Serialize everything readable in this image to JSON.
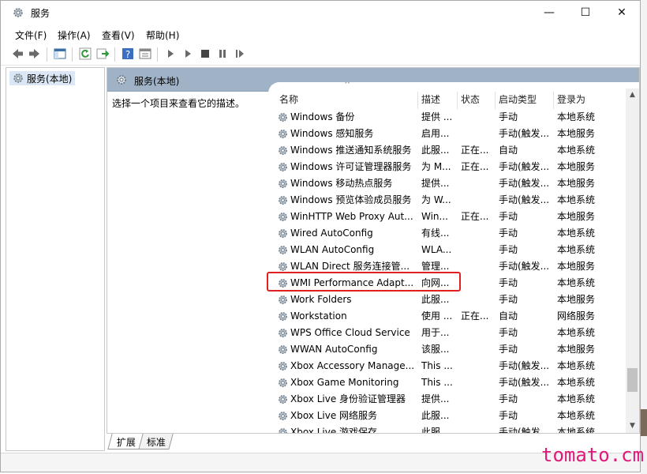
{
  "window": {
    "title": "服务"
  },
  "window_controls": {
    "minimize": "—",
    "maximize": "☐",
    "close": "✕"
  },
  "menu": [
    {
      "label": "文件(F)"
    },
    {
      "label": "操作(A)"
    },
    {
      "label": "查看(V)"
    },
    {
      "label": "帮助(H)"
    }
  ],
  "toolbar": {
    "icons": [
      "back-icon",
      "forward-icon",
      "show-hide-tree-icon",
      "refresh-icon",
      "export-icon",
      "help-icon",
      "properties-icon",
      "start-icon",
      "start-alt-icon",
      "stop-icon",
      "pause-icon",
      "restart-icon"
    ]
  },
  "tree": {
    "selected_label": "服务(本地)"
  },
  "main": {
    "header_title": "服务(本地)",
    "description_prompt": "选择一个项目来查看它的描述。",
    "sort_indicator": "^"
  },
  "columns": [
    "名称",
    "描述",
    "状态",
    "启动类型",
    "登录为"
  ],
  "services": [
    {
      "name": "Windows 备份",
      "desc": "提供 ...",
      "status": "",
      "startup": "手动",
      "login": "本地系统"
    },
    {
      "name": "Windows 感知服务",
      "desc": "启用...",
      "status": "",
      "startup": "手动(触发...",
      "login": "本地服务"
    },
    {
      "name": "Windows 推送通知系统服务",
      "desc": "此服...",
      "status": "正在...",
      "startup": "自动",
      "login": "本地系统"
    },
    {
      "name": "Windows 许可证管理器服务",
      "desc": "为 M...",
      "status": "正在...",
      "startup": "手动(触发...",
      "login": "本地服务"
    },
    {
      "name": "Windows 移动热点服务",
      "desc": "提供...",
      "status": "",
      "startup": "手动(触发...",
      "login": "本地服务"
    },
    {
      "name": "Windows 预览体验成员服务",
      "desc": "为 W...",
      "status": "",
      "startup": "手动(触发...",
      "login": "本地系统"
    },
    {
      "name": "WinHTTP Web Proxy Aut...",
      "desc": "Win...",
      "status": "正在...",
      "startup": "手动",
      "login": "本地服务"
    },
    {
      "name": "Wired AutoConfig",
      "desc": "有线...",
      "status": "",
      "startup": "手动",
      "login": "本地系统"
    },
    {
      "name": "WLAN AutoConfig",
      "desc": "WLA...",
      "status": "",
      "startup": "手动",
      "login": "本地系统"
    },
    {
      "name": "WLAN Direct 服务连接管...",
      "desc": "管理...",
      "status": "",
      "startup": "手动(触发...",
      "login": "本地服务"
    },
    {
      "name": "WMI Performance Adapt...",
      "desc": "向网...",
      "status": "",
      "startup": "手动",
      "login": "本地系统"
    },
    {
      "name": "Work Folders",
      "desc": "此服...",
      "status": "",
      "startup": "手动",
      "login": "本地服务"
    },
    {
      "name": "Workstation",
      "desc": "使用 ...",
      "status": "正在...",
      "startup": "自动",
      "login": "网络服务"
    },
    {
      "name": "WPS Office Cloud Service",
      "desc": "用于...",
      "status": "",
      "startup": "手动",
      "login": "本地系统"
    },
    {
      "name": "WWAN AutoConfig",
      "desc": "该服...",
      "status": "",
      "startup": "手动",
      "login": "本地服务"
    },
    {
      "name": "Xbox Accessory Manage...",
      "desc": "This ...",
      "status": "",
      "startup": "手动(触发...",
      "login": "本地系统"
    },
    {
      "name": "Xbox Game Monitoring",
      "desc": "This ...",
      "status": "",
      "startup": "手动(触发...",
      "login": "本地系统"
    },
    {
      "name": "Xbox Live 身份验证管理器",
      "desc": "提供...",
      "status": "",
      "startup": "手动",
      "login": "本地系统"
    },
    {
      "name": "Xbox Live 网络服务",
      "desc": "此服...",
      "status": "",
      "startup": "手动",
      "login": "本地系统"
    },
    {
      "name": "Xbox Live 游戏保存",
      "desc": "此服...",
      "status": "",
      "startup": "手动(触发...",
      "login": "本地系统"
    }
  ],
  "highlighted_service": "WMI Performance Adapt...",
  "tabs": [
    {
      "label": "扩展",
      "active": true
    },
    {
      "label": "标准",
      "active": false
    }
  ],
  "watermark": "tomato.cm",
  "colors": {
    "header_bg": "#9fb2c6",
    "highlight_border": "#e02020",
    "watermark": "#e0187a",
    "tree_selected_bg": "#dbe7f5"
  }
}
